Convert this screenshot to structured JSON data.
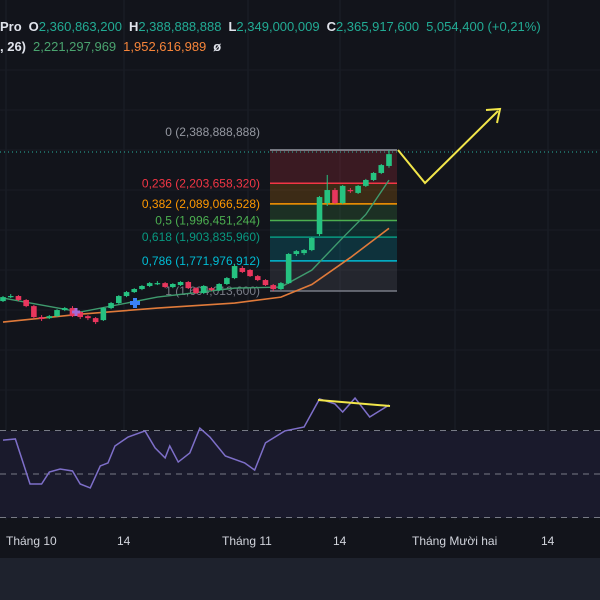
{
  "header": {
    "symbol_fragment": "Pro",
    "open_label": "O",
    "open": "2,360,863,200",
    "high_label": "H",
    "high": "2,388,888,888",
    "low_label": "L",
    "low": "2,349,000,009",
    "close_label": "C",
    "close": "2,365,917,600",
    "change": "5,054,400 (+0,21%)",
    "ma_fragment": ", 26)",
    "ma_fast": "2,221,297,969",
    "ma_slow": "1,952,616,989",
    "ma_extra": "ø"
  },
  "colors": {
    "background": "#12141b",
    "up": "#26c281",
    "down": "#e8365d",
    "ma_fast": "#3f9b6e",
    "ma_slow": "#e07a3a",
    "rsi": "#7e6fc9",
    "drawing": "#f2e64a"
  },
  "fibonacci": [
    {
      "ratio": "0",
      "price": "2,388,888,888",
      "value": 2388888888,
      "color": "#9598a1"
    },
    {
      "ratio": "0,236",
      "price": "2,203,658,320",
      "value": 2203658320,
      "color": "#f23645"
    },
    {
      "ratio": "0,382",
      "price": "2,089,066,528",
      "value": 2089066528,
      "color": "#ff9800"
    },
    {
      "ratio": "0,5",
      "price": "1,996,451,244",
      "value": 1996451244,
      "color": "#4caf50"
    },
    {
      "ratio": "0,618",
      "price": "1,903,835,960",
      "value": 1903835960,
      "color": "#089981"
    },
    {
      "ratio": "0,786",
      "price": "1,771,976,912",
      "value": 1771976912,
      "color": "#00bcd4"
    },
    {
      "ratio": "1",
      "price": "1,604,013,600",
      "value": 1604013600,
      "color": "#787b86"
    }
  ],
  "time_axis": [
    "Tháng 10",
    "14",
    "Tháng 11",
    "14",
    "Tháng Mười hai",
    "14"
  ],
  "chart_data": {
    "type": "candlestick",
    "candles": [
      [
        1548000000.0,
        1576000000.0,
        1543000000.0,
        1570000000.0
      ],
      [
        1570000000.0,
        1587000000.0,
        1565000000.0,
        1576000000.0
      ],
      [
        1576000000.0,
        1581000000.0,
        1548000000.0,
        1554000000.0
      ],
      [
        1554000000.0,
        1559000000.0,
        1514000000.0,
        1520000000.0
      ],
      [
        1520000000.0,
        1526000000.0,
        1448000000.0,
        1459000000.0
      ],
      [
        1459000000.0,
        1470000000.0,
        1437000000.0,
        1448000000.0
      ],
      [
        1453000000.0,
        1470000000.0,
        1448000000.0,
        1464000000.0
      ],
      [
        1464000000.0,
        1503000000.0,
        1459000000.0,
        1498000000.0
      ],
      [
        1498000000.0,
        1515000000.0,
        1492000000.0,
        1509000000.0
      ],
      [
        1509000000.0,
        1520000000.0,
        1459000000.0,
        1464000000.0
      ],
      [
        1487000000.0,
        1492000000.0,
        1448000000.0,
        1459000000.0
      ],
      [
        1464000000.0,
        1470000000.0,
        1442000000.0,
        1453000000.0
      ],
      [
        1453000000.0,
        1459000000.0,
        1420000000.0,
        1431000000.0
      ],
      [
        1442000000.0,
        1515000000.0,
        1437000000.0,
        1509000000.0
      ],
      [
        1509000000.0,
        1543000000.0,
        1503000000.0,
        1537000000.0
      ],
      [
        1537000000.0,
        1581000000.0,
        1531000000.0,
        1576000000.0
      ],
      [
        1576000000.0,
        1604000000.0,
        1570000000.0,
        1598000000.0
      ],
      [
        1598000000.0,
        1620000000.0,
        1593000000.0,
        1615000000.0
      ],
      [
        1615000000.0,
        1637000000.0,
        1609000000.0,
        1632000000.0
      ],
      [
        1632000000.0,
        1654000000.0,
        1626000000.0,
        1648000000.0
      ],
      [
        1643000000.0,
        1659000000.0,
        1637000000.0,
        1648000000.0
      ],
      [
        1648000000.0,
        1654000000.0,
        1620000000.0,
        1626000000.0
      ],
      [
        1626000000.0,
        1648000000.0,
        1620000000.0,
        1643000000.0
      ],
      [
        1637000000.0,
        1659000000.0,
        1632000000.0,
        1654000000.0
      ],
      [
        1654000000.0,
        1659000000.0,
        1615000000.0,
        1620000000.0
      ],
      [
        1620000000.0,
        1626000000.0,
        1587000000.0,
        1593000000.0
      ],
      [
        1593000000.0,
        1637000000.0,
        1587000000.0,
        1632000000.0
      ],
      [
        1620000000.0,
        1626000000.0,
        1604000000.0,
        1609000000.0
      ],
      [
        1609000000.0,
        1648000000.0,
        1604000000.0,
        1643000000.0
      ],
      [
        1643000000.0,
        1682000000.0,
        1637000000.0,
        1676000000.0
      ],
      [
        1676000000.0,
        1754000000.0,
        1670000000.0,
        1743000000.0
      ],
      [
        1732000000.0,
        1743000000.0,
        1704000000.0,
        1710000000.0
      ],
      [
        1721000000.0,
        1726000000.0,
        1682000000.0,
        1687000000.0
      ],
      [
        1687000000.0,
        1693000000.0,
        1659000000.0,
        1665000000.0
      ],
      [
        1665000000.0,
        1670000000.0,
        1632000000.0,
        1637000000.0
      ],
      [
        1637000000.0,
        1643000000.0,
        1604000000.0,
        1615000000.0
      ],
      [
        1615000000.0,
        1654000000.0,
        1609000000.0,
        1648000000.0
      ],
      [
        1648000000.0,
        1815000000.0,
        1643000000.0,
        1810000000.0
      ],
      [
        1810000000.0,
        1832000000.0,
        1799000000.0,
        1826000000.0
      ],
      [
        1815000000.0,
        1838000000.0,
        1804000000.0,
        1832000000.0
      ],
      [
        1832000000.0,
        1904000000.0,
        1826000000.0,
        1899000000.0
      ],
      [
        1921000000.0,
        2133000000.0,
        1910000000.0,
        2127000000.0
      ],
      [
        2094000000.0,
        2250000000.0,
        2077000000.0,
        2166000000.0
      ],
      [
        2166000000.0,
        2177000000.0,
        2088000000.0,
        2094000000.0
      ],
      [
        2094000000.0,
        2194000000.0,
        2088000000.0,
        2189000000.0
      ],
      [
        2166000000.0,
        2177000000.0,
        2150000000.0,
        2161000000.0
      ],
      [
        2150000000.0,
        2194000000.0,
        2144000000.0,
        2189000000.0
      ],
      [
        2189000000.0,
        2228000000.0,
        2183000000.0,
        2222000000.0
      ],
      [
        2222000000.0,
        2266000000.0,
        2216000000.0,
        2261000000.0
      ],
      [
        2261000000.0,
        2311000000.0,
        2255000000.0,
        2305000000.0
      ],
      [
        2300000000.0,
        2388888888.0,
        2290000000.0,
        2365917600.0
      ]
    ],
    "ma_fast": [
      [
        0,
        1565000000.0
      ],
      [
        10,
        1487000000.0
      ],
      [
        20,
        1570000000.0
      ],
      [
        30,
        1620000000.0
      ],
      [
        36,
        1626000000.0
      ],
      [
        40,
        1720000000.0
      ],
      [
        44,
        1900000000.0
      ],
      [
        47,
        2030000000.0
      ],
      [
        50,
        2221000000.0
      ]
    ],
    "ma_slow": [
      [
        0,
        1431000000.0
      ],
      [
        10,
        1475000000.0
      ],
      [
        20,
        1509000000.0
      ],
      [
        30,
        1537000000.0
      ],
      [
        36,
        1570000000.0
      ],
      [
        40,
        1640000000.0
      ],
      [
        45,
        1790000000.0
      ],
      [
        50,
        1953000000.0
      ]
    ],
    "rsi": [
      [
        0,
        65.6
      ],
      [
        1.6,
        66.1
      ],
      [
        3.5,
        45.4
      ],
      [
        5,
        45.4
      ],
      [
        6,
        50.9
      ],
      [
        7.4,
        52.3
      ],
      [
        9,
        51.4
      ],
      [
        10,
        45.4
      ],
      [
        11.3,
        43.6
      ],
      [
        12.6,
        53.7
      ],
      [
        13.6,
        55.1
      ],
      [
        14.5,
        62.9
      ],
      [
        16.2,
        67.0
      ],
      [
        18.4,
        69.8
      ],
      [
        19.7,
        62.0
      ],
      [
        21,
        57.4
      ],
      [
        21.6,
        62.9
      ],
      [
        22.7,
        55.5
      ],
      [
        24.2,
        59.7
      ],
      [
        25.5,
        71.1
      ],
      [
        26.8,
        67.0
      ],
      [
        28.8,
        58.3
      ],
      [
        31.3,
        55.1
      ],
      [
        32.6,
        51.8
      ],
      [
        34,
        64.3
      ],
      [
        36.5,
        69.8
      ],
      [
        39,
        71.6
      ],
      [
        41,
        84.5
      ],
      [
        43,
        82.2
      ],
      [
        44,
        78.5
      ],
      [
        45.6,
        84.9
      ],
      [
        47.5,
        76.2
      ],
      [
        50,
        81.7
      ]
    ],
    "rsi_levels": [
      70,
      50,
      30
    ]
  }
}
